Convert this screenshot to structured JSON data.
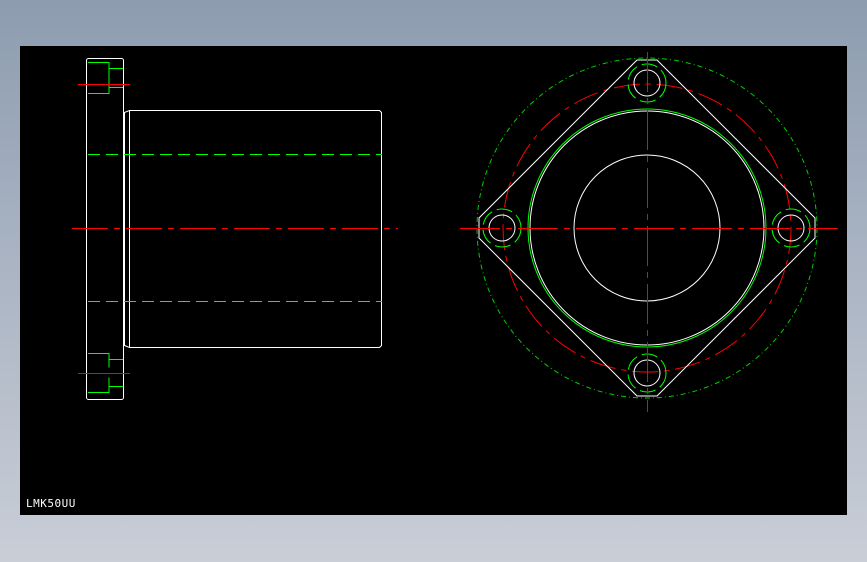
{
  "drawing": {
    "part_label": "LMK50UU"
  },
  "colors": {
    "background": "#000000",
    "outline": "#ffffff",
    "centerline": "#ff0000",
    "hidden": "#00ff00",
    "construction": "#00cc00"
  }
}
